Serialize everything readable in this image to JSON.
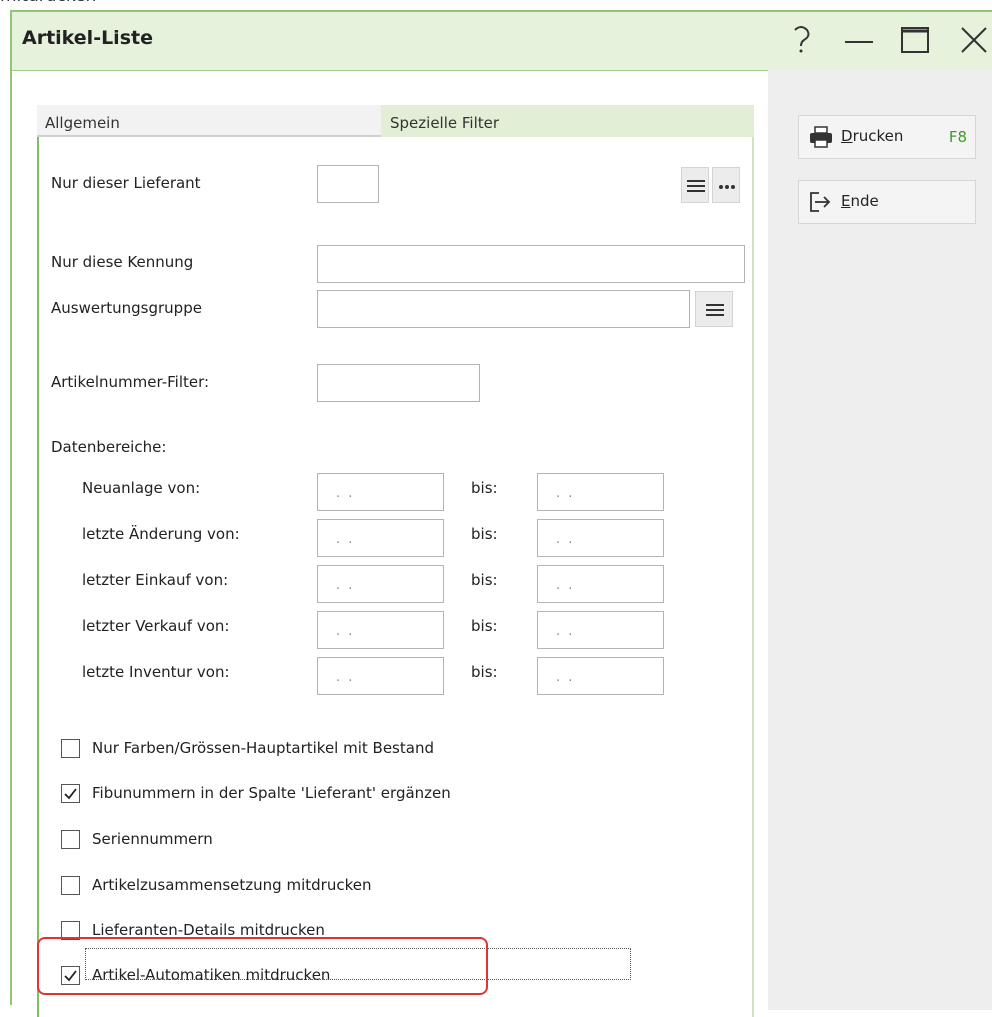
{
  "top_cut_text": "mitdrucken",
  "window": {
    "title": "Artikel-Liste",
    "controls": {
      "help": "?",
      "minimize": "minimize-icon",
      "maximize": "maximize-icon",
      "close": "close-icon"
    }
  },
  "tabs": [
    {
      "label": "Allgemein",
      "active": false
    },
    {
      "label": "Spezielle Filter",
      "active": true
    }
  ],
  "filters": {
    "lieferant": {
      "label": "Nur dieser Lieferant",
      "value": ""
    },
    "kennung": {
      "label": "Nur diese Kennung",
      "value": ""
    },
    "auswertungsgruppe": {
      "label": "Auswertungsgruppe",
      "value": ""
    },
    "artikelnummer": {
      "label": "Artikelnummer-Filter:",
      "value": ""
    }
  },
  "datenbereiche": {
    "heading": "Datenbereiche:",
    "rows": [
      {
        "label": "Neuanlage von:",
        "bis": "bis:",
        "from": ". .",
        "to": ". ."
      },
      {
        "label": "letzte Änderung von:",
        "bis": "bis:",
        "from": ". .",
        "to": ". ."
      },
      {
        "label": "letzter Einkauf von:",
        "bis": "bis:",
        "from": ". .",
        "to": ". ."
      },
      {
        "label": "letzter Verkauf von:",
        "bis": "bis:",
        "from": ". .",
        "to": ". ."
      },
      {
        "label": "letzte Inventur von:",
        "bis": "bis:",
        "from": ". .",
        "to": ". ."
      }
    ]
  },
  "options": [
    {
      "label": "Nur Farben/Grössen-Hauptartikel mit Bestand",
      "checked": false
    },
    {
      "label": "Fibunummern in der Spalte 'Lieferant' ergänzen",
      "checked": true
    },
    {
      "label": "Seriennummern",
      "checked": false
    },
    {
      "label": "Artikelzusammensetzung mitdrucken",
      "checked": false
    },
    {
      "label": "Lieferanten-Details mitdrucken",
      "checked": false
    },
    {
      "label": "Artikel-Automatiken mitdrucken",
      "checked": true
    }
  ],
  "side_buttons": {
    "print": {
      "mnemonic": "D",
      "rest": "rucken",
      "key": "F8",
      "icon": "printer-icon"
    },
    "end": {
      "mnemonic": "E",
      "rest": "nde",
      "icon": "exit-icon"
    }
  },
  "colors": {
    "accent_green": "#8dc878",
    "key_green": "#3f9a2c",
    "highlight_red": "#e03434"
  }
}
